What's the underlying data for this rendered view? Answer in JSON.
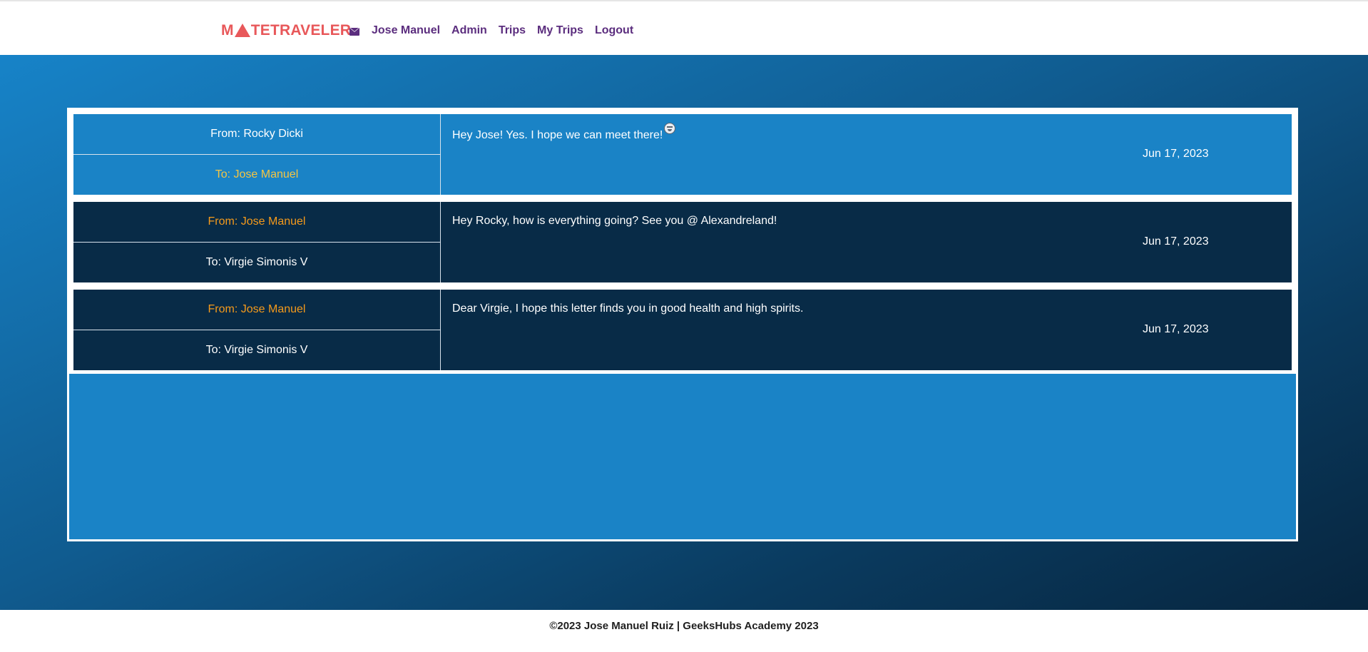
{
  "header": {
    "logo": {
      "part1": "M",
      "part2": "TETRAVELER"
    },
    "nav": {
      "user_name": "Jose Manuel",
      "admin": "Admin",
      "trips": "Trips",
      "my_trips": "My Trips",
      "logout": "Logout"
    }
  },
  "messages": [
    {
      "from": "From: Rocky Dicki",
      "to": "To: Jose Manuel",
      "text": "Hey Jose! Yes. I hope we can meet there!",
      "date": "Jun 17, 2023"
    },
    {
      "from": "From: Jose Manuel",
      "to": "To: Virgie Simonis V",
      "text": "Hey Rocky, how is everything going? See you @ Alexandreland!",
      "date": "Jun 17, 2023"
    },
    {
      "from": "From: Jose Manuel",
      "to": "To: Virgie Simonis V",
      "text": "Dear Virgie, I hope this letter finds you in good health and high spirits.",
      "date": "Jun 17, 2023"
    }
  ],
  "footer": {
    "text": "©2023 Jose Manuel Ruiz | GeeksHubs Academy 2023"
  },
  "colors": {
    "brand": "#e8585a",
    "nav": "#5b2d7e",
    "message_light": "#1a83c6",
    "message_dark": "#082b47",
    "highlight_yellow": "#f5c542",
    "highlight_orange": "#f59a1b"
  }
}
